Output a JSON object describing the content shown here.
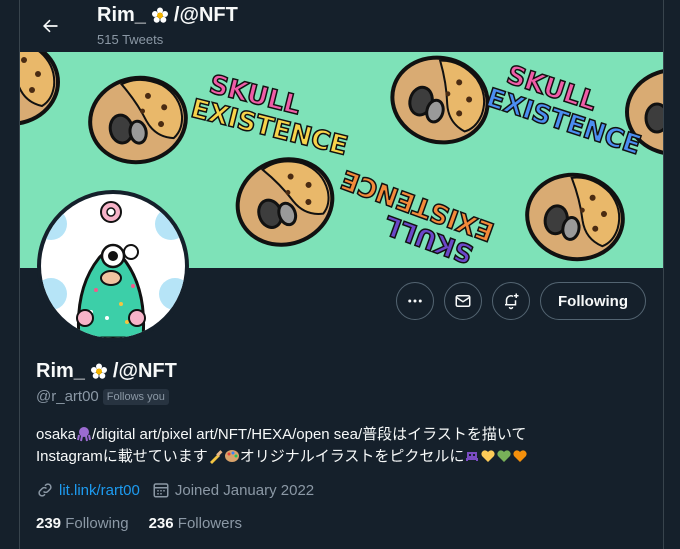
{
  "header": {
    "title": "Rim_ ✿ /@NFT",
    "title_text": "Rim_",
    "title_suffix": "/@NFT",
    "tweet_count": "515 Tweets"
  },
  "banner": {
    "text_top": "SKULL",
    "text_bottom": "EXISTENCE",
    "background_color": "#7ee2b8"
  },
  "actions": {
    "more_icon": "more-icon",
    "message_icon": "envelope-icon",
    "notify_icon": "bell-plus-icon",
    "follow_label": "Following"
  },
  "profile": {
    "name_text": "Rim_",
    "name_suffix": "/@NFT",
    "handle": "@r_art00",
    "follows_you": "Follows you",
    "bio_line1_a": "osaka",
    "bio_line1_b": "/digital art/pixel art/NFT/HEXA/open sea/普段はイラストを描いて",
    "bio_line2_a": "Instagramに載せています",
    "bio_line2_b": "オリジナルイラストをピクセルに",
    "link": "lit.link/rart00",
    "joined": "Joined January 2022"
  },
  "stats": {
    "following_count": "239",
    "following_label": "Following",
    "followers_count": "236",
    "followers_label": "Followers"
  }
}
